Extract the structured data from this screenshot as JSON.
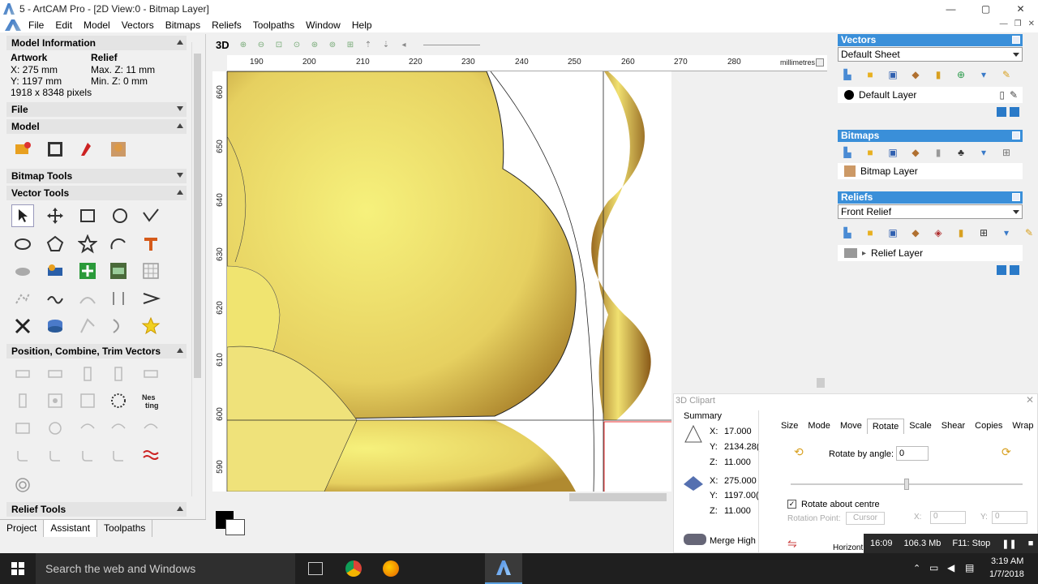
{
  "window": {
    "title": "5 - ArtCAM Pro - [2D View:0 - Bitmap Layer]",
    "min": "—",
    "max": "▢",
    "close": "✕"
  },
  "menu": [
    "File",
    "Edit",
    "Model",
    "Vectors",
    "Bitmaps",
    "Reliefs",
    "Toolpaths",
    "Window",
    "Help"
  ],
  "model_info": {
    "header": "Model Information",
    "artwork_label": "Artwork",
    "relief_label": "Relief",
    "x": "X: 275 mm",
    "y": "Y: 1197 mm",
    "maxz": "Max. Z: 11 mm",
    "minz": "Min. Z: 0 mm",
    "pixels": "1918 x 8348 pixels"
  },
  "sections": {
    "file": "File",
    "model": "Model",
    "bitmap_tools": "Bitmap Tools",
    "vector_tools": "Vector Tools",
    "position": "Position, Combine, Trim Vectors",
    "relief_tools": "Relief Tools"
  },
  "left_tabs": [
    "Project",
    "Assistant",
    "Toolpaths"
  ],
  "view_toolbar": {
    "mode": "3D"
  },
  "ruler": {
    "units": "millimetres",
    "top": [
      "190",
      "200",
      "210",
      "220",
      "230",
      "240",
      "250",
      "260",
      "270",
      "280"
    ],
    "left": [
      "660",
      "650",
      "640",
      "630",
      "620",
      "610",
      "600",
      "590"
    ]
  },
  "vectors": {
    "header": "Vectors",
    "sheet": "Default Sheet",
    "layer": "Default Layer"
  },
  "bitmaps": {
    "header": "Bitmaps",
    "layer": "Bitmap Layer"
  },
  "reliefs": {
    "header": "Reliefs",
    "relief": "Front Relief",
    "layer": "Relief Layer"
  },
  "clipart": {
    "title": "3D Clipart",
    "summary": "Summary",
    "tabs": [
      "Size",
      "Mode",
      "Move",
      "Rotate",
      "Scale",
      "Shear",
      "Copies",
      "Wrap"
    ],
    "active_tab": "Rotate",
    "x1": "X:",
    "x1v": "17.000",
    "y1": "Y:",
    "y1v": "2134.28(",
    "z1": "Z:",
    "z1v": "11.000",
    "x2": "X:",
    "x2v": "275.000",
    "y2": "Y:",
    "y2v": "1197.00(",
    "z2": "Z:",
    "z2v": "11.000",
    "merge": "Merge High",
    "rotate_by_angle": "Rotate by angle:",
    "angle": "0",
    "rotate_about_centre": "Rotate about centre",
    "rotation_point": "Rotation Point:",
    "cursor": "Cursor",
    "rx": "X:",
    "rxv": "0",
    "ry": "Y:",
    "ryv": "0",
    "horizontal": "Horizont"
  },
  "status": {
    "time": "16:09",
    "mem": "106.3 Mb",
    "stop": "F11: Stop"
  },
  "taskbar": {
    "search": "Search the web and Windows",
    "clock": "3:19 AM",
    "date": "1/7/2018"
  }
}
